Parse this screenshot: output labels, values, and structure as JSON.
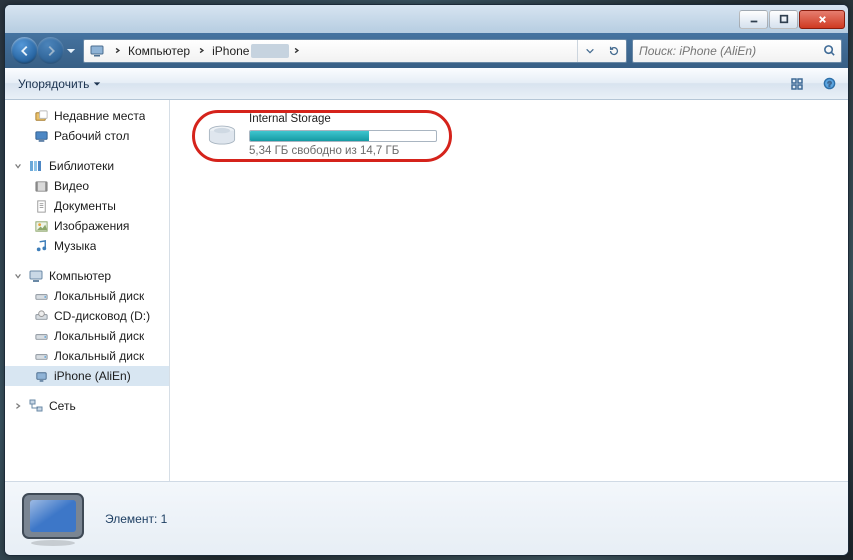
{
  "breadcrumb": {
    "root": "Компьютер",
    "device": "iPhone"
  },
  "search": {
    "placeholder": "Поиск: iPhone (AliEn)"
  },
  "toolbar": {
    "organize": "Упорядочить"
  },
  "sidebar": {
    "quick": [
      {
        "label": "Недавние места",
        "icon": "recent"
      },
      {
        "label": "Рабочий стол",
        "icon": "desktop"
      }
    ],
    "libraries_header": "Библиотеки",
    "libraries": [
      {
        "label": "Видео",
        "icon": "video"
      },
      {
        "label": "Документы",
        "icon": "docs"
      },
      {
        "label": "Изображения",
        "icon": "pics"
      },
      {
        "label": "Музыка",
        "icon": "music"
      }
    ],
    "computer_header": "Компьютер",
    "computer": [
      {
        "label": "Локальный диск",
        "icon": "hdd"
      },
      {
        "label": "CD-дисковод (D:)",
        "icon": "cd"
      },
      {
        "label": "Локальный диск",
        "icon": "hdd"
      },
      {
        "label": "Локальный диск",
        "icon": "hdd"
      },
      {
        "label": "iPhone (AliEn)",
        "icon": "iphone",
        "selected": true
      }
    ],
    "network_header": "Сеть"
  },
  "content": {
    "drive": {
      "name": "Internal Storage",
      "free_text": "5,34 ГБ свободно из 14,7 ГБ",
      "used_percent": 64
    }
  },
  "details": {
    "count_label": "Элемент: 1"
  }
}
